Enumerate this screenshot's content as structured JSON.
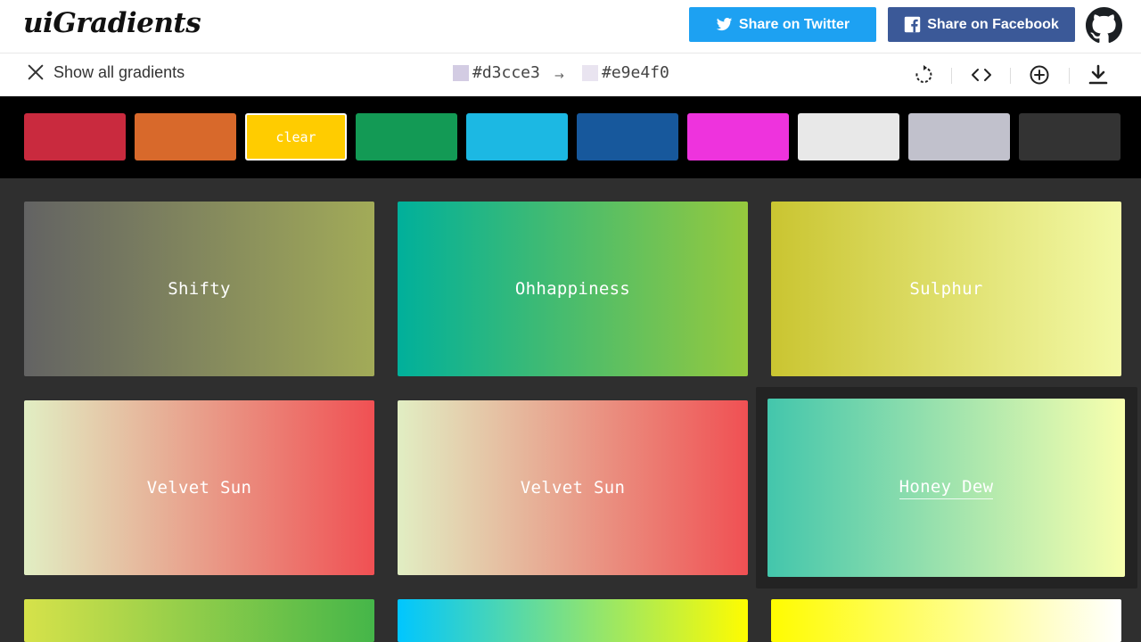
{
  "header": {
    "logo": "uiGradients",
    "twitter_label": "Share on Twitter",
    "facebook_label": "Share on Facebook"
  },
  "subbar": {
    "show_all_label": "Show all gradients",
    "color_from": "#d3cce3",
    "color_to": "#e9e4f0",
    "arrow": "→"
  },
  "icons": {
    "close": "close-icon",
    "twitter": "twitter-icon",
    "facebook": "facebook-icon",
    "github": "github-icon",
    "rotate": "rotate-icon",
    "code": "code-icon",
    "add": "add-circle-icon",
    "download": "download-icon"
  },
  "filters": [
    {
      "color": "#c92a3e",
      "label": ""
    },
    {
      "color": "#d8692b",
      "label": ""
    },
    {
      "color": "#ffcc00",
      "label": "clear"
    },
    {
      "color": "#139a55",
      "label": ""
    },
    {
      "color": "#1cb8e3",
      "label": ""
    },
    {
      "color": "#17589c",
      "label": ""
    },
    {
      "color": "#ee33dd",
      "label": ""
    },
    {
      "color": "#e8e8e8",
      "label": ""
    },
    {
      "color": "#c1c1cc",
      "label": ""
    },
    {
      "color": "#333333",
      "label": ""
    }
  ],
  "gradients": [
    {
      "name": "Shifty",
      "from": "#636363",
      "to": "#a2ab58"
    },
    {
      "name": "Ohhappiness",
      "from": "#00b09b",
      "to": "#96c93d"
    },
    {
      "name": "Sulphur",
      "from": "#cac531",
      "to": "#f3f9a7"
    },
    {
      "name": "Velvet Sun",
      "from": "#e1eec3",
      "to": "#f05053"
    },
    {
      "name": "Velvet Sun",
      "from": "#e1eec3",
      "to": "#f05053"
    },
    {
      "name": "Honey Dew",
      "from": "#43c6ac",
      "to": "#f8ffae"
    },
    {
      "name": "",
      "from": "#d6e24a",
      "to": "#45b649"
    },
    {
      "name": "",
      "from": "#00c6ff",
      "to": "#fffc00"
    },
    {
      "name": "",
      "from": "#fffc00",
      "to": "#ffffff"
    }
  ]
}
